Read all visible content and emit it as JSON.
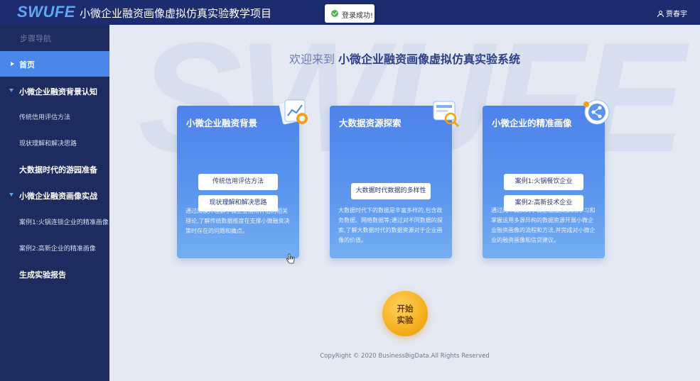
{
  "header": {
    "logo": "SWUFE",
    "title": "小微企业融资画像虚拟仿真实验教学项目",
    "toast": "登录成功!",
    "user": "贾春宇"
  },
  "sidebar": {
    "heading": "步骤导航",
    "items": [
      {
        "label": "首页",
        "marker": "caret-right",
        "active": true
      },
      {
        "label": "小微企业融资背景认知",
        "marker": "caret-down"
      },
      {
        "label": "传统信用评估方法"
      },
      {
        "label": "现状理解和解决思路"
      },
      {
        "label": "大数据时代的游园准备"
      },
      {
        "label": "小微企业融资画像实战",
        "marker": "caret-down"
      },
      {
        "label": "案例1:火锅连锁企业的精准画像"
      },
      {
        "label": "案例2:高新企业的精准画像"
      },
      {
        "label": "生成实验报告"
      }
    ]
  },
  "main": {
    "watermark": "SWUFE",
    "welcome_prefix": "欢迎来到",
    "welcome_highlight": "小微企业融资画像虚拟仿真实验系统",
    "cards": [
      {
        "title": "小微企业融资背景",
        "buttons": [
          "传统信用评估方法",
          "现状理解和解决思路"
        ],
        "desc": "通过阅读并理解小微企业信用评估的相关理论,了解传统数据维度在支撑小微融资决策时存在的问题和痛点。",
        "icon": "chart-document-icon"
      },
      {
        "title": "大数据资源探索",
        "buttons": [
          "大数据时代数据的多样性"
        ],
        "desc": "大数据时代下的数据是丰富多样的,包含政务数据、网络数据等;通过对不同数据的探索,了解大数据时代的数据资源对于企业画像的价值。",
        "icon": "search-data-icon"
      },
      {
        "title": "小微企业的精准画像",
        "buttons": [
          "案例1:火锅餐饮企业",
          "案例2:高新技术企业"
        ],
        "desc": "通过两个真实的小微企业融资案例,学习和掌握运用多源异构的数据资源开展小微企业融资画像的流程和方法,并完成对小微企业的融资画像和信贷建议。",
        "icon": "share-network-icon"
      }
    ],
    "start_button": [
      "开始",
      "实验"
    ],
    "copyright": "CopyRight © 2020 BusinessBigData.All Rights Reserved"
  },
  "colors": {
    "topbar": "#1c2c6e",
    "sidebar": "#1e2b5e",
    "active_nav": "#4a87e8",
    "card": "#5b95ee",
    "start_button": "#f2a915"
  }
}
